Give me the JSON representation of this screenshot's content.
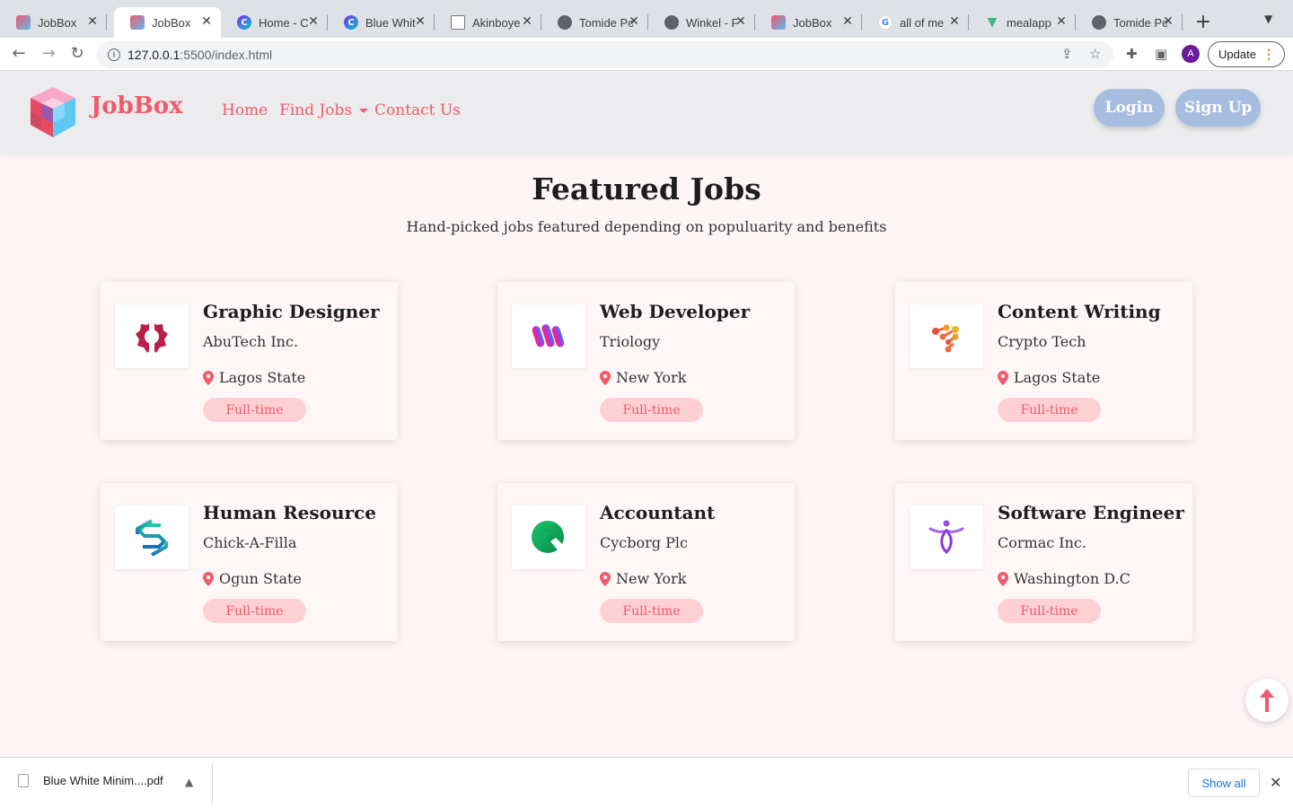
{
  "browser": {
    "tabs": [
      {
        "title": "JobBox",
        "icon": "jobbox-cube-icon",
        "active": false
      },
      {
        "title": "JobBox",
        "icon": "jobbox-cube-icon",
        "active": true
      },
      {
        "title": "Home - C",
        "icon": "canva-icon",
        "active": false
      },
      {
        "title": "Blue Whit",
        "icon": "canva-icon",
        "active": false
      },
      {
        "title": "Akinboye",
        "icon": "document-icon",
        "active": false
      },
      {
        "title": "Tomide Po",
        "icon": "globe-icon",
        "active": false
      },
      {
        "title": "Winkel - F",
        "icon": "globe-icon",
        "active": false
      },
      {
        "title": "JobBox",
        "icon": "jobbox-cube-icon",
        "active": false
      },
      {
        "title": "all of me",
        "icon": "google-icon",
        "active": false
      },
      {
        "title": "mealapp",
        "icon": "vue-icon",
        "active": false
      },
      {
        "title": "Tomide Po",
        "icon": "globe-icon",
        "active": false
      }
    ],
    "url_host": "127.0.0.1",
    "url_path": ":5500/index.html",
    "profile_initial": "A",
    "update_label": "Update",
    "accent": "#e37400"
  },
  "site": {
    "brand": "JobBox",
    "nav": {
      "home": "Home",
      "find_jobs": "Find Jobs",
      "contact": "Contact Us"
    },
    "login": "Login",
    "signup": "Sign Up",
    "brand_color": "#f15a6a",
    "button_color": "#a7bde0"
  },
  "featured": {
    "title": "Featured Jobs",
    "subtitle": "Hand-picked jobs featured depending on populuarity and benefits",
    "jobs": [
      {
        "title": "Graphic Designer",
        "company": "AbuTech Inc.",
        "location": "Lagos State",
        "type": "Full-time",
        "logo": "gear-logo-icon"
      },
      {
        "title": "Web Developer",
        "company": "Triology",
        "location": "New York",
        "type": "Full-time",
        "logo": "w-logo-icon"
      },
      {
        "title": "Content Writing",
        "company": "Crypto Tech",
        "location": "Lagos State",
        "type": "Full-time",
        "logo": "dots-logo-icon"
      },
      {
        "title": "Human Resource",
        "company": "Chick-A-Filla",
        "location": "Ogun State",
        "type": "Full-time",
        "logo": "s-logo-icon"
      },
      {
        "title": "Accountant",
        "company": "Cycborg Plc",
        "location": "New York",
        "type": "Full-time",
        "logo": "leaf-logo-icon"
      },
      {
        "title": "Software Engineer",
        "company": "Cormac Inc.",
        "location": "Washington D.C",
        "type": "Full-time",
        "logo": "figure-logo-icon"
      }
    ]
  },
  "downloads": {
    "file": "Blue White Minim....pdf",
    "show_all": "Show all"
  }
}
